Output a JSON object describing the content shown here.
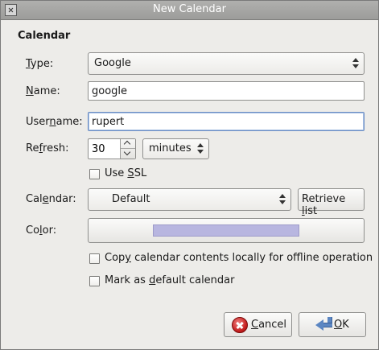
{
  "window": {
    "title": "New Calendar"
  },
  "section": {
    "title": "Calendar"
  },
  "form": {
    "type": {
      "label_pre": "",
      "label_key": "T",
      "label_post": "ype:",
      "value": "Google"
    },
    "name": {
      "label_pre": "",
      "label_key": "N",
      "label_post": "ame:",
      "value": "google"
    },
    "username": {
      "label_pre": "User",
      "label_key": "n",
      "label_post": "ame:",
      "value": "rupert"
    },
    "refresh": {
      "label_pre": "Re",
      "label_key": "f",
      "label_post": "resh:",
      "value": "30",
      "unit": "minutes"
    },
    "ssl": {
      "label_pre": "Use ",
      "label_key": "S",
      "label_post": "SL",
      "checked": false
    },
    "calendar": {
      "label_pre": "Cal",
      "label_key": "e",
      "label_post": "ndar:",
      "value": "Default",
      "retrieve_pre": "Retrieve ",
      "retrieve_key": "l",
      "retrieve_post": "ist"
    },
    "color": {
      "label_pre": "Co",
      "label_key": "l",
      "label_post": "or:",
      "swatch": "#b8b6e0"
    },
    "offline": {
      "label_pre": "Cop",
      "label_key": "y",
      "label_post": " calendar contents locally for offline operation",
      "checked": false
    },
    "default": {
      "label_pre": "Mark as ",
      "label_key": "d",
      "label_post": "efault calendar",
      "checked": false
    }
  },
  "buttons": {
    "cancel": {
      "pre": "",
      "key": "C",
      "post": "ancel"
    },
    "ok": {
      "pre": "",
      "key": "O",
      "post": "K"
    }
  }
}
